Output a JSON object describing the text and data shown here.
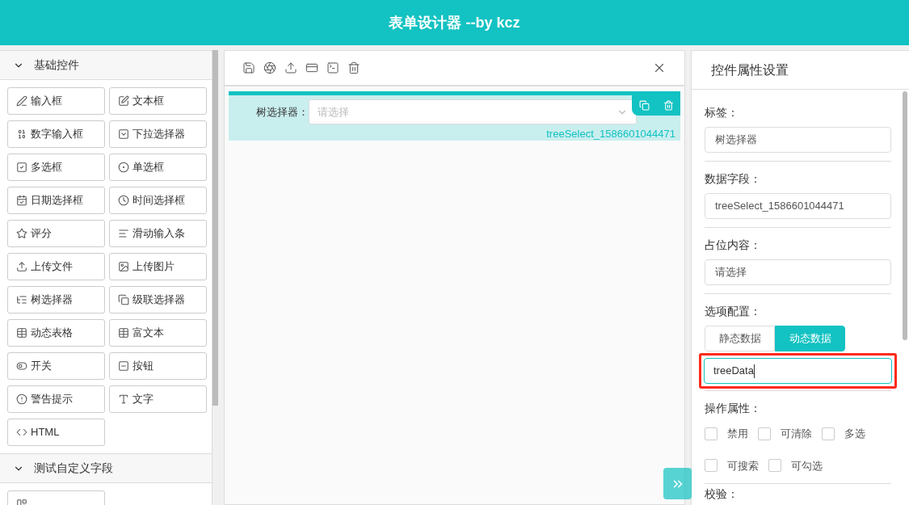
{
  "header": {
    "title": "表单设计器 --by kcz"
  },
  "sidebar": {
    "groups": [
      {
        "title": "基础控件",
        "expanded": true,
        "items": [
          {
            "label": "输入框",
            "kind": "pen"
          },
          {
            "label": "文本框",
            "kind": "edit"
          },
          {
            "label": "数字输入框",
            "kind": "number"
          },
          {
            "label": "下拉选择器",
            "kind": "dropdown"
          },
          {
            "label": "多选框",
            "kind": "checkbox"
          },
          {
            "label": "单选框",
            "kind": "radio"
          },
          {
            "label": "日期选择框",
            "kind": "calendar"
          },
          {
            "label": "时间选择框",
            "kind": "clock"
          },
          {
            "label": "评分",
            "kind": "star"
          },
          {
            "label": "滑动输入条",
            "kind": "lines"
          },
          {
            "label": "上传文件",
            "kind": "upload"
          },
          {
            "label": "上传图片",
            "kind": "image"
          },
          {
            "label": "树选择器",
            "kind": "tree"
          },
          {
            "label": "级联选择器",
            "kind": "cascade"
          },
          {
            "label": "动态表格",
            "kind": "table"
          },
          {
            "label": "富文本",
            "kind": "table"
          },
          {
            "label": "开关",
            "kind": "toggle"
          },
          {
            "label": "按钮",
            "kind": "button"
          },
          {
            "label": "警告提示",
            "kind": "alert"
          },
          {
            "label": "文字",
            "kind": "text"
          },
          {
            "label": "HTML",
            "kind": "code"
          }
        ]
      },
      {
        "title": "测试自定义字段",
        "expanded": true,
        "items": [
          {
            "kind": "custom"
          }
        ]
      }
    ]
  },
  "canvas": {
    "fields": [
      {
        "label": "树选择器：",
        "placeholder": "请选择",
        "model": "treeSelect_1586601044471",
        "selected": true
      }
    ]
  },
  "properties": {
    "title": "控件属性设置",
    "sections": [
      {
        "kind": "input",
        "label": "标签：",
        "value": "树选择器"
      },
      {
        "kind": "input",
        "label": "数据字段：",
        "value": "treeSelect_1586601044471"
      },
      {
        "kind": "input",
        "label": "占位内容：",
        "value": "请选择"
      },
      {
        "kind": "options",
        "label": "选项配置：",
        "tabs": [
          {
            "label": "静态数据",
            "selected": false
          },
          {
            "label": "动态数据",
            "selected": true
          }
        ],
        "value": "treeData",
        "highlighted": true
      },
      {
        "kind": "checkboxes",
        "label": "操作属性：",
        "options": [
          {
            "label": "禁用",
            "checked": false
          },
          {
            "label": "可清除",
            "checked": false
          },
          {
            "label": "多选",
            "checked": false
          },
          {
            "label": "可搜索",
            "checked": false
          },
          {
            "label": "可勾选",
            "checked": false
          }
        ]
      },
      {
        "kind": "heading",
        "label": "校验："
      }
    ]
  }
}
